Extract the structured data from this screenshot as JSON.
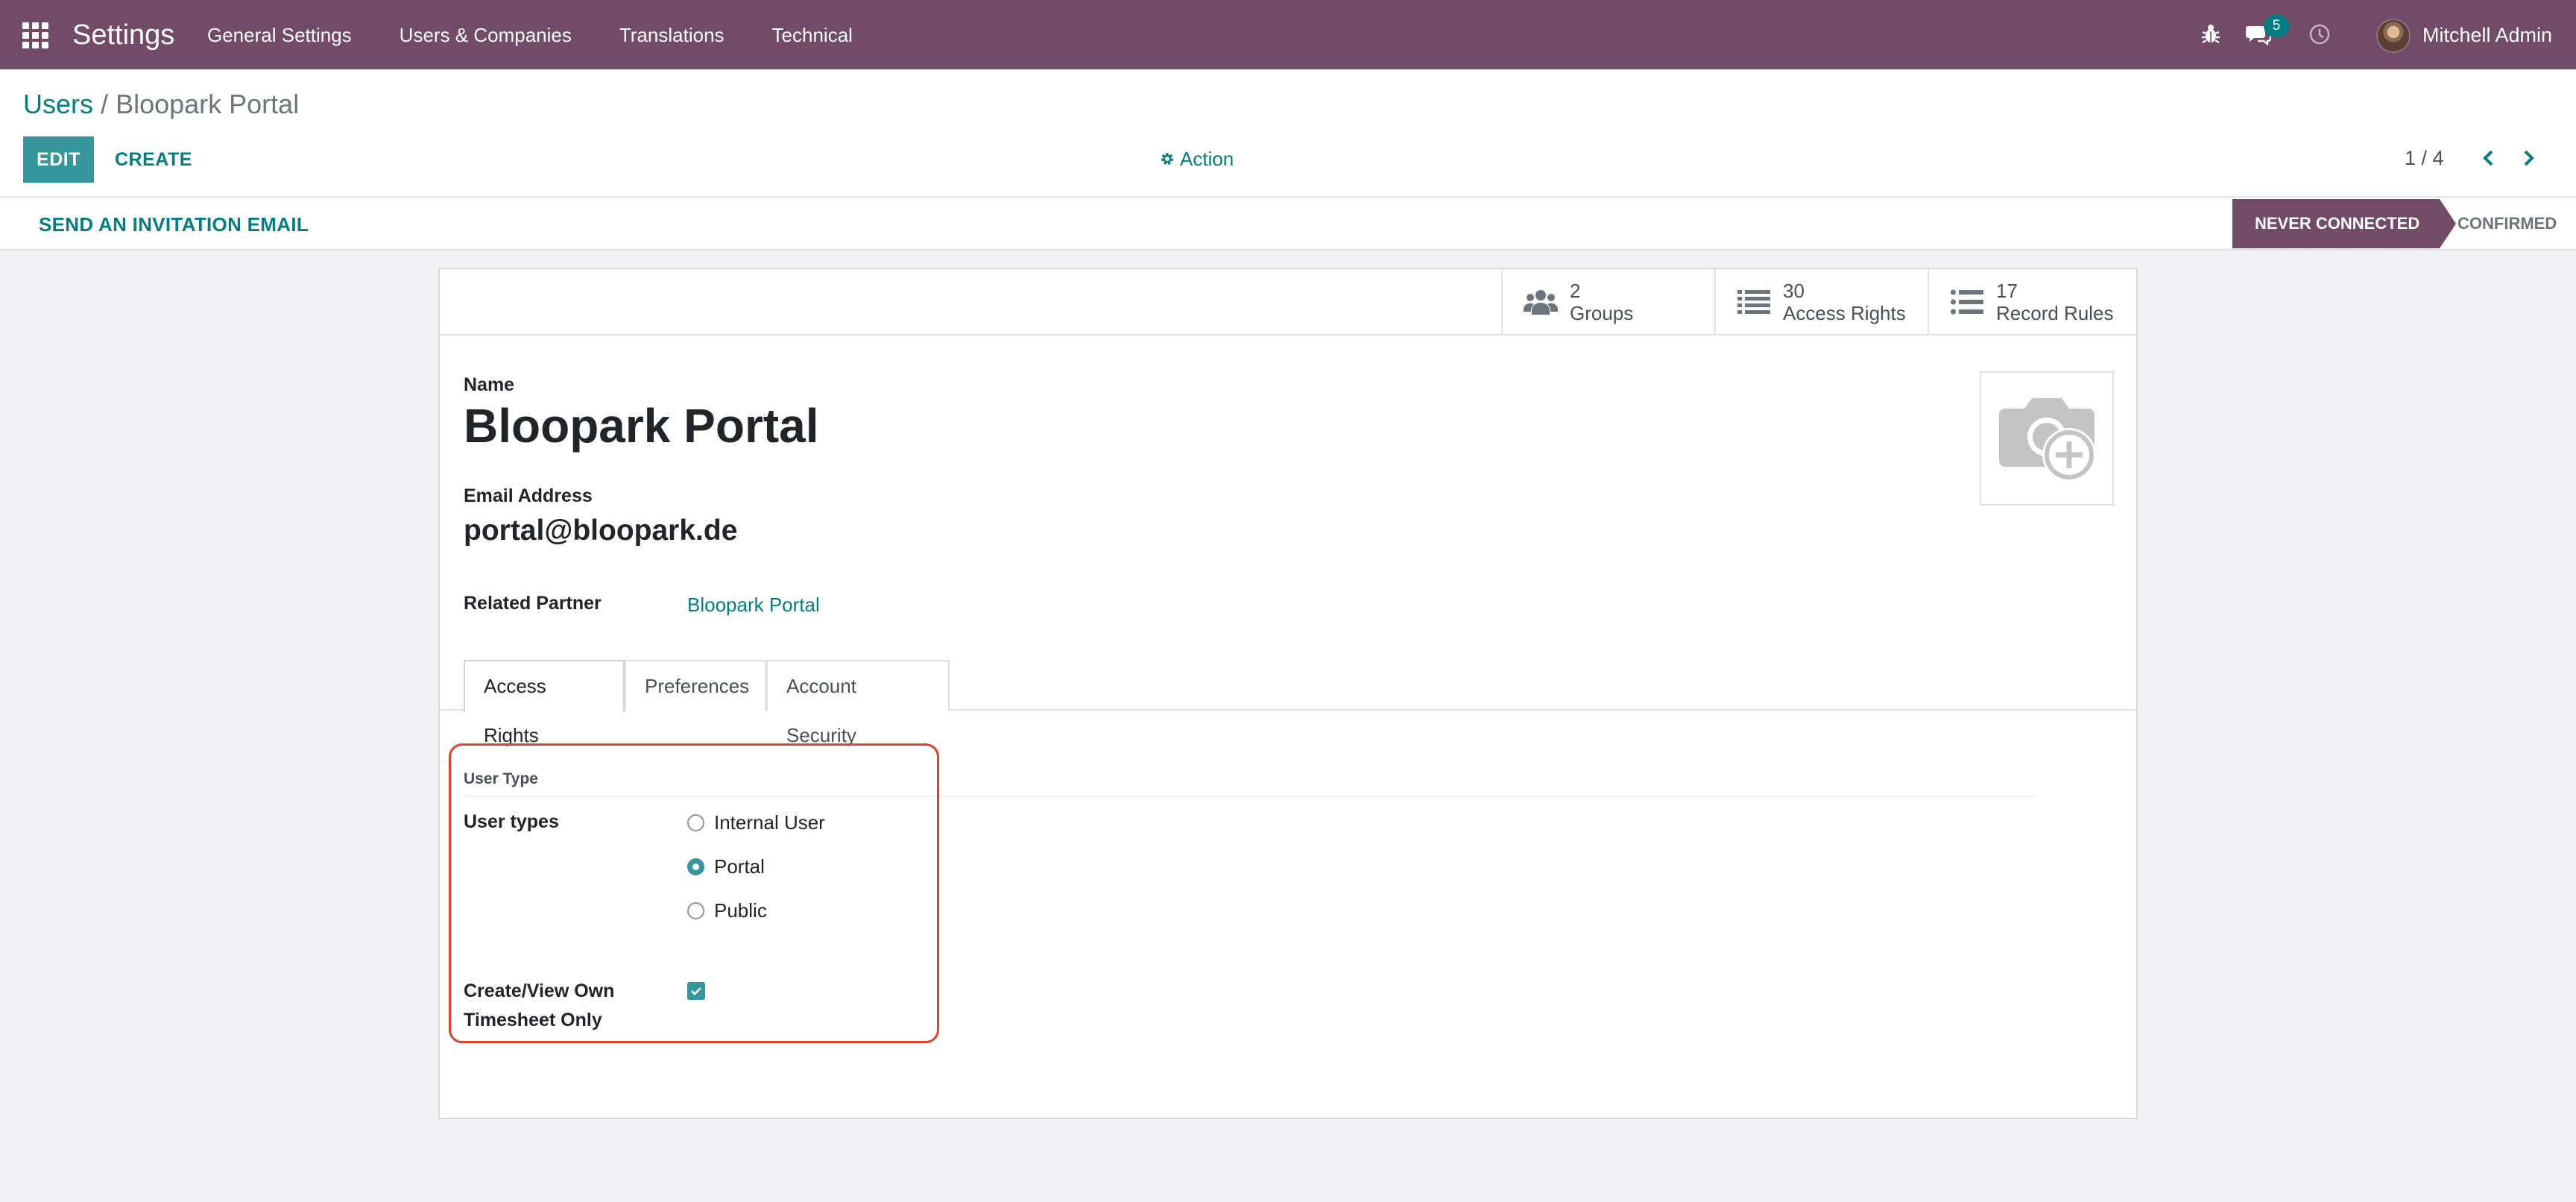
{
  "navbar": {
    "app_title": "Settings",
    "menu": [
      "General Settings",
      "Users & Companies",
      "Translations",
      "Technical"
    ],
    "chat_count": "5",
    "user_name": "Mitchell Admin",
    "icons": [
      "apps-grid-icon",
      "bug-icon",
      "chat-icon",
      "clock-icon"
    ]
  },
  "control_panel": {
    "breadcrumb": {
      "parent": "Users",
      "separator": "/",
      "current": "Bloopark Portal"
    },
    "edit_label": "EDIT",
    "create_label": "CREATE",
    "action_label": "Action",
    "pager": "1 / 4"
  },
  "statusbar": {
    "invite_label": "SEND AN INVITATION EMAIL",
    "stages": [
      {
        "label": "NEVER CONNECTED",
        "active": true
      },
      {
        "label": "CONFIRMED",
        "active": false
      }
    ]
  },
  "stat_buttons": [
    {
      "value": "2",
      "label": "Groups",
      "icon": "users-icon"
    },
    {
      "value": "30",
      "label": "Access Rights",
      "icon": "list-icon"
    },
    {
      "value": "17",
      "label": "Record Rules",
      "icon": "list-icon"
    }
  ],
  "form": {
    "name_label": "Name",
    "name_value": "Bloopark Portal",
    "email_label": "Email Address",
    "email_value": "portal@bloopark.de",
    "partner_label": "Related Partner",
    "partner_value": "Bloopark Portal",
    "image_placeholder_icon": "camera-add-icon"
  },
  "tabs": [
    {
      "label": "Access Rights",
      "active": true
    },
    {
      "label": "Preferences",
      "active": false
    },
    {
      "label": "Account Security",
      "active": false
    }
  ],
  "access_rights": {
    "group_title": "User Type",
    "user_types_label": "User types",
    "options": [
      {
        "label": "Internal User",
        "checked": false
      },
      {
        "label": "Portal",
        "checked": true
      },
      {
        "label": "Public",
        "checked": false
      }
    ],
    "timesheet_label_line1": "Create/View Own",
    "timesheet_label_line2": "Timesheet Only",
    "timesheet_checked": true
  },
  "colors": {
    "navbar": "#714b67",
    "primary": "#35979c",
    "link": "#017e84",
    "highlight": "#e0412f"
  }
}
